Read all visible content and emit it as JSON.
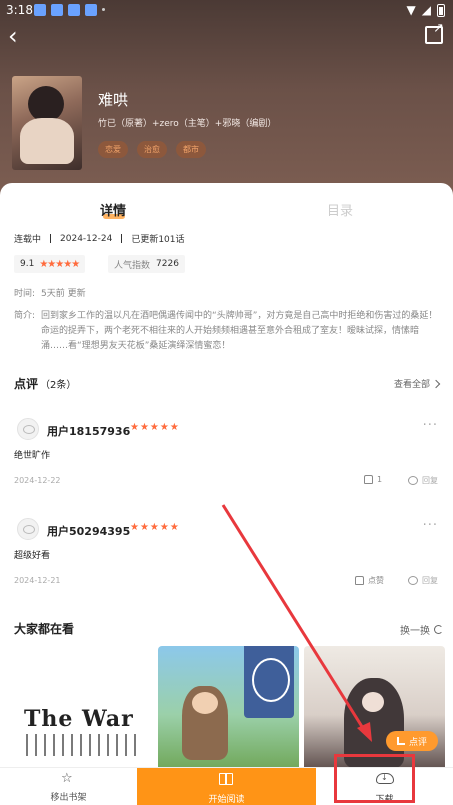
{
  "status_bar": {
    "time": "3:18"
  },
  "book": {
    "title": "难哄",
    "authors": "竹已（原著）+zero（主笔）+邪晓（编剧）",
    "tags": [
      "恋爱",
      "治愈",
      "都市"
    ]
  },
  "tabs": {
    "details": "详情",
    "catalog": "目录"
  },
  "meta": {
    "status": "连载中",
    "date": "2024-12-24",
    "updates": "已更新101话",
    "rating": "9.1",
    "popularity_label": "人气指数",
    "popularity_value": "7226",
    "time_label": "时间:",
    "time_value": "5天前 更新",
    "intro_label": "简介:",
    "intro_text": "回到家乡工作的温以凡在酒吧偶遇传闻中的“头牌帅哥”，对方竟是自己高中时拒绝和伤害过的桑延！命运的捉弄下，两个老死不相往来的人开始频频相遇甚至意外合租成了室友！暧昧试探，情愫暗涌……看“理想男友天花板”桑延演绎深情蜜恋！"
  },
  "reviews": {
    "title": "点评",
    "count": "（2条）",
    "see_all": "查看全部",
    "items": [
      {
        "user": "用户18157936",
        "text": "绝世旷作",
        "date": "2024-12-22",
        "likes": "1",
        "reply": "回复"
      },
      {
        "user": "用户50294395",
        "text": "超级好看",
        "date": "2024-12-21",
        "likes": "点赞",
        "reply": "回复"
      }
    ]
  },
  "recommend": {
    "title": "大家都在看",
    "shuffle": "换一换",
    "books": [
      {
        "cover_text": "The War"
      },
      {
        "cover_text": ""
      },
      {
        "cover_text": ""
      }
    ]
  },
  "fab": {
    "label": "点评"
  },
  "bottom_nav": {
    "remove": "移出书架",
    "read": "开始阅读",
    "download": "下载"
  },
  "colors": {
    "accent": "#ff9416",
    "star": "#ff6b3d",
    "highlight": "#e8383d"
  }
}
